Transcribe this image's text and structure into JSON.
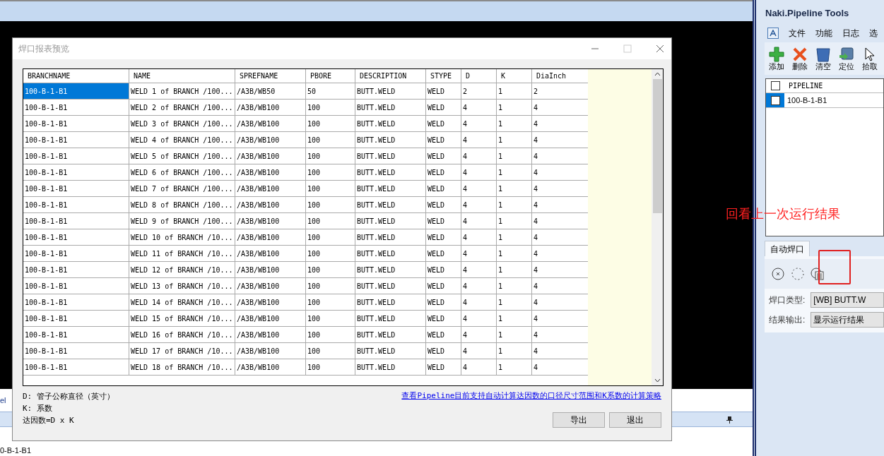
{
  "background_window": {
    "side_label": "el",
    "list_rows": [
      "0-B-1-B1"
    ]
  },
  "dialog": {
    "title": "焊口报表预览",
    "table": {
      "columns": [
        "BRANCHNAME",
        "NAME",
        "SPREFNAME",
        "PBORE",
        "DESCRIPTION",
        "STYPE",
        "D",
        "K",
        "DiaInch"
      ],
      "rows": [
        {
          "selected": true,
          "cells": [
            "100-B-1-B1",
            "WELD 1 of BRANCH /100...",
            "/A3B/WB50",
            "50",
            "BUTT.WELD",
            "WELD",
            "2",
            "1",
            "2"
          ]
        },
        {
          "selected": false,
          "cells": [
            "100-B-1-B1",
            "WELD 2 of BRANCH /100...",
            "/A3B/WB100",
            "100",
            "BUTT.WELD",
            "WELD",
            "4",
            "1",
            "4"
          ]
        },
        {
          "selected": false,
          "cells": [
            "100-B-1-B1",
            "WELD 3 of BRANCH /100...",
            "/A3B/WB100",
            "100",
            "BUTT.WELD",
            "WELD",
            "4",
            "1",
            "4"
          ]
        },
        {
          "selected": false,
          "cells": [
            "100-B-1-B1",
            "WELD 4 of BRANCH /100...",
            "/A3B/WB100",
            "100",
            "BUTT.WELD",
            "WELD",
            "4",
            "1",
            "4"
          ]
        },
        {
          "selected": false,
          "cells": [
            "100-B-1-B1",
            "WELD 5 of BRANCH /100...",
            "/A3B/WB100",
            "100",
            "BUTT.WELD",
            "WELD",
            "4",
            "1",
            "4"
          ]
        },
        {
          "selected": false,
          "cells": [
            "100-B-1-B1",
            "WELD 6 of BRANCH /100...",
            "/A3B/WB100",
            "100",
            "BUTT.WELD",
            "WELD",
            "4",
            "1",
            "4"
          ]
        },
        {
          "selected": false,
          "cells": [
            "100-B-1-B1",
            "WELD 7 of BRANCH /100...",
            "/A3B/WB100",
            "100",
            "BUTT.WELD",
            "WELD",
            "4",
            "1",
            "4"
          ]
        },
        {
          "selected": false,
          "cells": [
            "100-B-1-B1",
            "WELD 8 of BRANCH /100...",
            "/A3B/WB100",
            "100",
            "BUTT.WELD",
            "WELD",
            "4",
            "1",
            "4"
          ]
        },
        {
          "selected": false,
          "cells": [
            "100-B-1-B1",
            "WELD 9 of BRANCH /100...",
            "/A3B/WB100",
            "100",
            "BUTT.WELD",
            "WELD",
            "4",
            "1",
            "4"
          ]
        },
        {
          "selected": false,
          "cells": [
            "100-B-1-B1",
            "WELD 10 of BRANCH /10...",
            "/A3B/WB100",
            "100",
            "BUTT.WELD",
            "WELD",
            "4",
            "1",
            "4"
          ]
        },
        {
          "selected": false,
          "cells": [
            "100-B-1-B1",
            "WELD 11 of BRANCH /10...",
            "/A3B/WB100",
            "100",
            "BUTT.WELD",
            "WELD",
            "4",
            "1",
            "4"
          ]
        },
        {
          "selected": false,
          "cells": [
            "100-B-1-B1",
            "WELD 12 of BRANCH /10...",
            "/A3B/WB100",
            "100",
            "BUTT.WELD",
            "WELD",
            "4",
            "1",
            "4"
          ]
        },
        {
          "selected": false,
          "cells": [
            "100-B-1-B1",
            "WELD 13 of BRANCH /10...",
            "/A3B/WB100",
            "100",
            "BUTT.WELD",
            "WELD",
            "4",
            "1",
            "4"
          ]
        },
        {
          "selected": false,
          "cells": [
            "100-B-1-B1",
            "WELD 14 of BRANCH /10...",
            "/A3B/WB100",
            "100",
            "BUTT.WELD",
            "WELD",
            "4",
            "1",
            "4"
          ]
        },
        {
          "selected": false,
          "cells": [
            "100-B-1-B1",
            "WELD 15 of BRANCH /10...",
            "/A3B/WB100",
            "100",
            "BUTT.WELD",
            "WELD",
            "4",
            "1",
            "4"
          ]
        },
        {
          "selected": false,
          "cells": [
            "100-B-1-B1",
            "WELD 16 of BRANCH /10...",
            "/A3B/WB100",
            "100",
            "BUTT.WELD",
            "WELD",
            "4",
            "1",
            "4"
          ]
        },
        {
          "selected": false,
          "cells": [
            "100-B-1-B1",
            "WELD 17 of BRANCH /10...",
            "/A3B/WB100",
            "100",
            "BUTT.WELD",
            "WELD",
            "4",
            "1",
            "4"
          ]
        },
        {
          "selected": false,
          "cells": [
            "100-B-1-B1",
            "WELD 18 of BRANCH /10...",
            "/A3B/WB100",
            "100",
            "BUTT.WELD",
            "WELD",
            "4",
            "1",
            "4"
          ]
        }
      ]
    },
    "notes": [
      "D: 管子公称直径（英寸）",
      "K: 系数",
      "达因数=D x K"
    ],
    "link": "查看Pipeline目前支持自动计算达因数的口径尺寸范围和K系数的计算策略",
    "buttons": [
      "导出",
      "退出"
    ]
  },
  "tool_panel": {
    "title": "Naki.Pipeline Tools",
    "menu": [
      "文件",
      "功能",
      "日志",
      "选"
    ],
    "toolbar": [
      {
        "label": "添加",
        "kind": "add"
      },
      {
        "label": "删除",
        "kind": "delete"
      },
      {
        "label": "清空",
        "kind": "clear"
      },
      {
        "label": "定位",
        "kind": "locate"
      },
      {
        "label": "拾取",
        "kind": "pick"
      }
    ],
    "list": {
      "column": "PIPELINE",
      "header_checked": false,
      "rows": [
        {
          "name": "100-B-1-B1",
          "checked": false,
          "selected": true
        }
      ]
    },
    "tabs": [
      {
        "label": "自动焊口",
        "selected": true
      }
    ],
    "fields": [
      {
        "label": "焊口类型:",
        "value": "[WB] BUTT.W"
      },
      {
        "label": "结果输出:",
        "value": "显示运行结果"
      }
    ]
  },
  "annotation": {
    "text": "回看上一次运行结果"
  }
}
